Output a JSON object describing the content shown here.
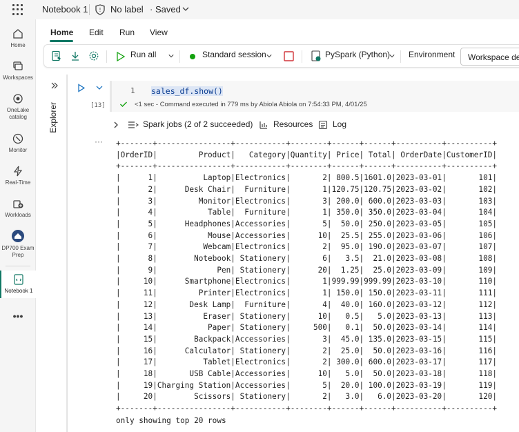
{
  "titlebar": {
    "notebook_name": "Notebook 1",
    "label": "No label",
    "saved": "· Saved"
  },
  "leftnav": {
    "items": [
      {
        "label": "Home",
        "icon": "home-icon"
      },
      {
        "label": "Workspaces",
        "icon": "workspaces-icon"
      },
      {
        "label": "OneLake catalog",
        "icon": "onelake-icon"
      },
      {
        "label": "Monitor",
        "icon": "monitor-icon"
      },
      {
        "label": "Real-Time",
        "icon": "realtime-icon"
      },
      {
        "label": "Workloads",
        "icon": "workloads-icon"
      },
      {
        "label": "DP700 Exam Prep",
        "icon": "workspace-icon"
      },
      {
        "label": "Notebook 1",
        "icon": "notebook-icon"
      },
      {
        "label": "•••",
        "icon": "more-icon"
      }
    ]
  },
  "ribbon": {
    "tabs": [
      "Home",
      "Edit",
      "Run",
      "View"
    ],
    "active_tab": "Home"
  },
  "toolbar": {
    "run_all": "Run all",
    "session": "Standard session",
    "language": "PySpark (Python)",
    "environment": "Environment",
    "workspace_default": "Workspace default"
  },
  "explorer": {
    "label": "Explorer"
  },
  "cell": {
    "line_number": "1",
    "code": "sales_df.show()",
    "exec_count": "[13]",
    "exec_status": "<1 sec - Command executed in 779 ms by Abiola Abiola on 7:54:33 PM, 4/01/25",
    "spark_jobs": "Spark jobs (2 of 2 succeeded)",
    "resources": "Resources",
    "log": "Log"
  },
  "output": {
    "more_dots": "···",
    "columns": [
      "OrderID",
      "Product",
      "Category",
      "Quantity",
      "Price",
      "Total",
      "OrderDate",
      "CustomerID"
    ],
    "rows": [
      [
        "1",
        "Laptop",
        "Electronics",
        "2",
        "800.5",
        "1601.0",
        "2023-03-01",
        "101"
      ],
      [
        "2",
        "Desk Chair",
        "Furniture",
        "1",
        "120.75",
        "120.75",
        "2023-03-02",
        "102"
      ],
      [
        "3",
        "Monitor",
        "Electronics",
        "3",
        "200.0",
        "600.0",
        "2023-03-03",
        "103"
      ],
      [
        "4",
        "Table",
        "Furniture",
        "1",
        "350.0",
        "350.0",
        "2023-03-04",
        "104"
      ],
      [
        "5",
        "Headphones",
        "Accessories",
        "5",
        "50.0",
        "250.0",
        "2023-03-05",
        "105"
      ],
      [
        "6",
        "Mouse",
        "Accessories",
        "10",
        "25.5",
        "255.0",
        "2023-03-06",
        "106"
      ],
      [
        "7",
        "Webcam",
        "Electronics",
        "2",
        "95.0",
        "190.0",
        "2023-03-07",
        "107"
      ],
      [
        "8",
        "Notebook",
        "Stationery",
        "6",
        "3.5",
        "21.0",
        "2023-03-08",
        "108"
      ],
      [
        "9",
        "Pen",
        "Stationery",
        "20",
        "1.25",
        "25.0",
        "2023-03-09",
        "109"
      ],
      [
        "10",
        "Smartphone",
        "Electronics",
        "1",
        "999.99",
        "999.99",
        "2023-03-10",
        "110"
      ],
      [
        "11",
        "Printer",
        "Electronics",
        "1",
        "150.0",
        "150.0",
        "2023-03-11",
        "111"
      ],
      [
        "12",
        "Desk Lamp",
        "Furniture",
        "4",
        "40.0",
        "160.0",
        "2023-03-12",
        "112"
      ],
      [
        "13",
        "Eraser",
        "Stationery",
        "10",
        "0.5",
        "5.0",
        "2023-03-13",
        "113"
      ],
      [
        "14",
        "Paper",
        "Stationery",
        "500",
        "0.1",
        "50.0",
        "2023-03-14",
        "114"
      ],
      [
        "15",
        "Backpack",
        "Accessories",
        "3",
        "45.0",
        "135.0",
        "2023-03-15",
        "115"
      ],
      [
        "16",
        "Calculator",
        "Stationery",
        "2",
        "25.0",
        "50.0",
        "2023-03-16",
        "116"
      ],
      [
        "17",
        "Tablet",
        "Electronics",
        "2",
        "300.0",
        "600.0",
        "2023-03-17",
        "117"
      ],
      [
        "18",
        "USB Cable",
        "Accessories",
        "10",
        "5.0",
        "50.0",
        "2023-03-18",
        "118"
      ],
      [
        "19",
        "Charging Station",
        "Accessories",
        "5",
        "20.0",
        "100.0",
        "2023-03-19",
        "119"
      ],
      [
        "20",
        "Scissors",
        "Stationery",
        "2",
        "3.0",
        "6.0",
        "2023-03-20",
        "120"
      ]
    ],
    "footer": "only showing top 20 rows"
  },
  "colors": {
    "accent": "#117865",
    "run_green": "#13a10e",
    "session_dot": "#13a10e",
    "stop_red": "#d13438",
    "code_blue": "#0b3d91"
  }
}
